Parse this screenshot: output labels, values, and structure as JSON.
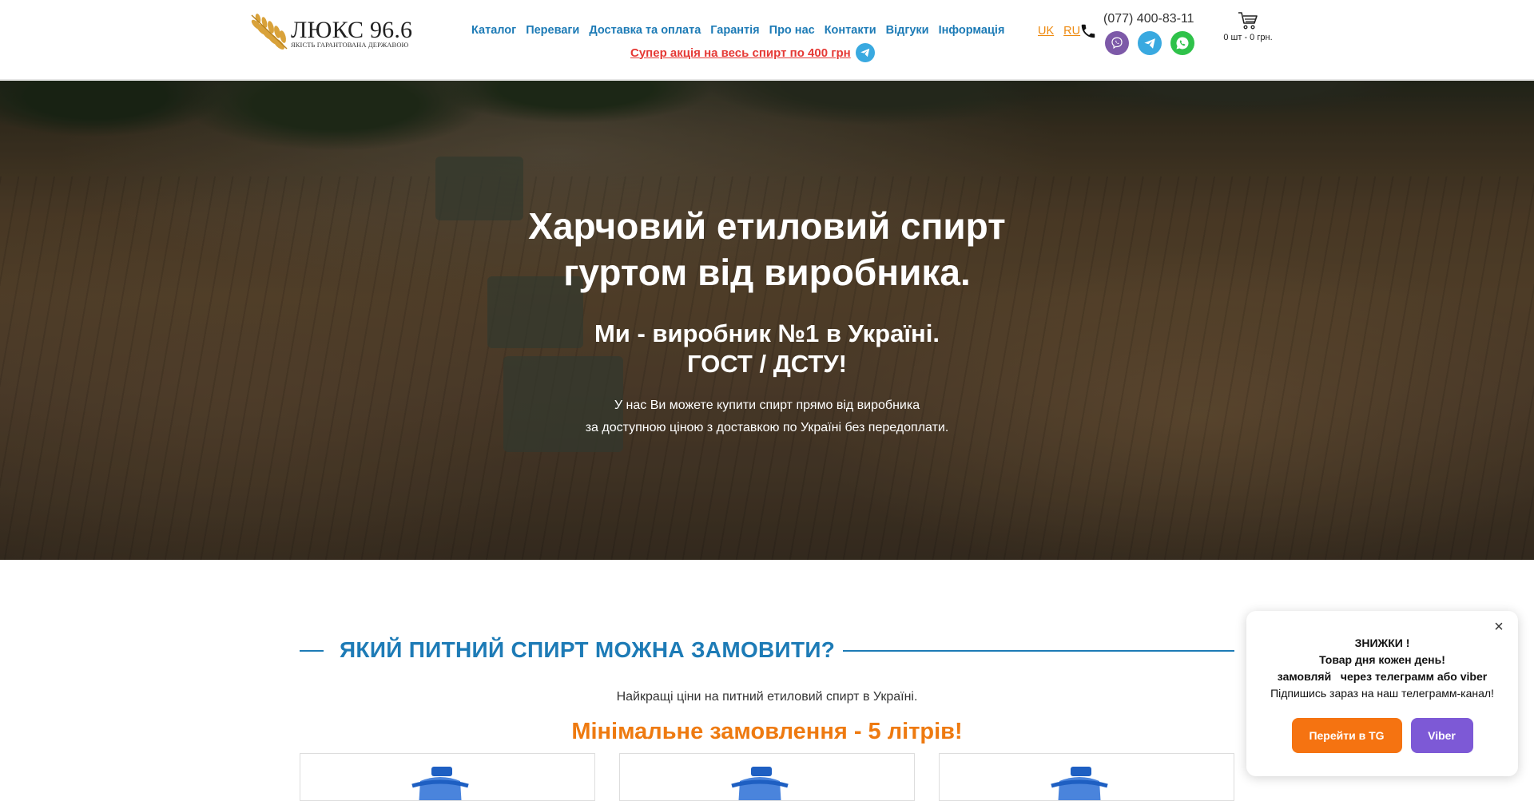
{
  "header": {
    "logo": {
      "title": "ЛЮКС 96.6",
      "subtitle": "ЯКІСТЬ ГАРАНТОВАНА ДЕРЖАВОЮ",
      "icon": "wheat-icon"
    },
    "nav": [
      {
        "label": "Каталог"
      },
      {
        "label": "Переваги"
      },
      {
        "label": "Доставка та оплата"
      },
      {
        "label": "Гарантія"
      },
      {
        "label": "Про нас"
      },
      {
        "label": "Контакти"
      },
      {
        "label": "Відгуки"
      },
      {
        "label": "Інформація"
      }
    ],
    "promo": {
      "label": "Супер акція на весь спирт по 400 грн",
      "icon": "telegram-icon"
    },
    "languages": [
      {
        "label": "UK"
      },
      {
        "label": "RU"
      }
    ],
    "phone": "(077) 400-83-11",
    "social": [
      {
        "icon": "viber-icon"
      },
      {
        "icon": "telegram-icon"
      },
      {
        "icon": "whatsapp-icon"
      }
    ],
    "cart": {
      "icon": "cart-icon",
      "text": "0 шт - 0 грн."
    },
    "colors": {
      "nav": "#1d7bb6",
      "promo": "#e53935",
      "lang": "#ee8a10"
    }
  },
  "hero": {
    "title_line1": "Харчовий етиловий спирт",
    "title_line2": "гуртом від виробника.",
    "subtitle_line1": "Ми - виробник №1 в Україні.",
    "subtitle_line2": "ГОСТ / ДСТУ!",
    "text_line1": "У нас Ви можете купити спирт прямо від виробника",
    "text_line2": "за доступною ціною з доставкою по Україні без передоплати."
  },
  "section": {
    "title": "ЯКИЙ ПИТНИЙ СПИРТ МОЖНА ЗАМОВИТИ?",
    "description": "Найкращі ціни на питний етиловий спирт в Україні.",
    "min_order": "Мінімальне замовлення - 5 літрів!",
    "colors": {
      "title": "#1d7bb6",
      "min_order": "#ee7a10"
    }
  },
  "popup": {
    "line1": "ЗНИЖКИ !",
    "line2": "Товар дня кожен день!",
    "line3": "замовляй   через телеграмм або viber",
    "line4": "Підпишись зараз на наш телеграмм-канал!",
    "btn_tg": "Перейти в TG",
    "btn_viber": "Viber",
    "close": "×",
    "colors": {
      "btn_tg": "#f57311",
      "btn_viber": "#7d59d6"
    }
  }
}
